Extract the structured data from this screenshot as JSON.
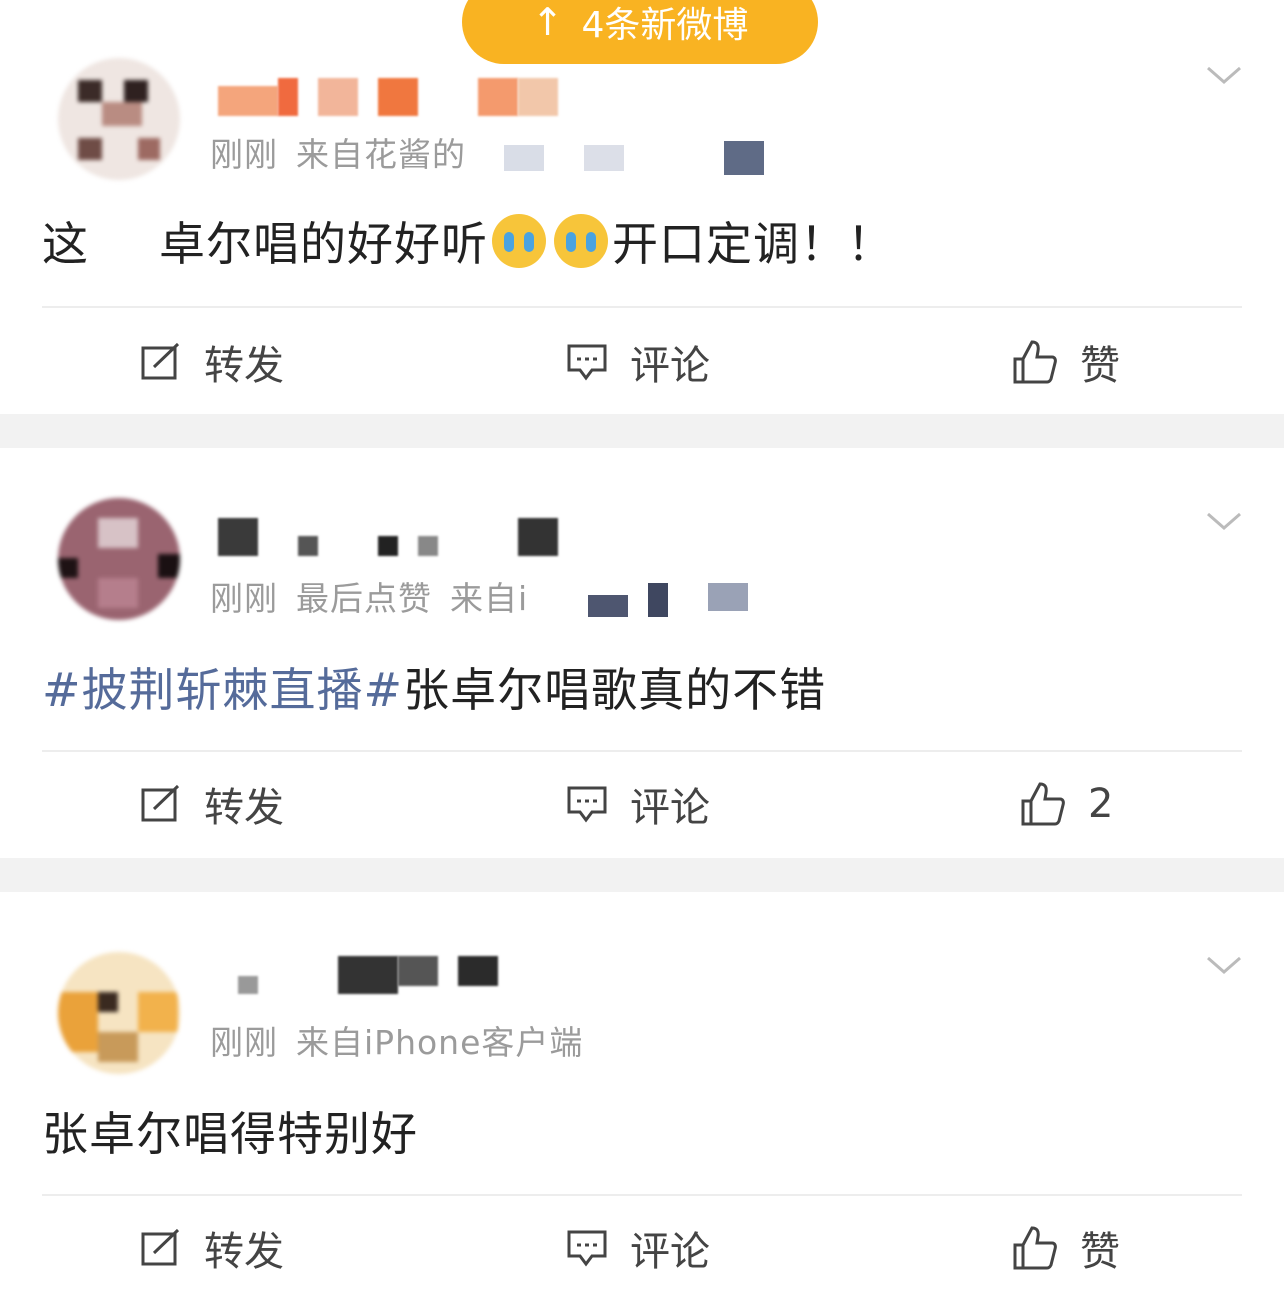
{
  "banner": {
    "arrow": "↑",
    "text": "4条新微博"
  },
  "posts": [
    {
      "meta": [
        "刚刚",
        "来自花酱的"
      ],
      "content_before": "这",
      "content_mid": "卓尔唱的好好听",
      "content_after": "开口定调！！",
      "actions": {
        "repost": "转发",
        "comment": "评论",
        "like": "赞"
      }
    },
    {
      "meta": [
        "刚刚",
        "最后点赞",
        "来自i"
      ],
      "topic": "#披荆斩棘直播#",
      "content": "张卓尔唱歌真的不错",
      "actions": {
        "repost": "转发",
        "comment": "评论",
        "like": "2"
      }
    },
    {
      "meta": [
        "刚刚",
        "来自iPhone客户端"
      ],
      "content": "张卓尔唱得特别好",
      "actions": {
        "repost": "转发",
        "comment": "评论",
        "like": "赞"
      }
    }
  ],
  "colors": {
    "accent": "#f9b322",
    "topic": "#556b9a",
    "meta": "#9b9b9b"
  },
  "icons": [
    "repost-icon",
    "comment-icon",
    "like-icon",
    "chevron-down-icon",
    "crying-emoji-icon"
  ]
}
